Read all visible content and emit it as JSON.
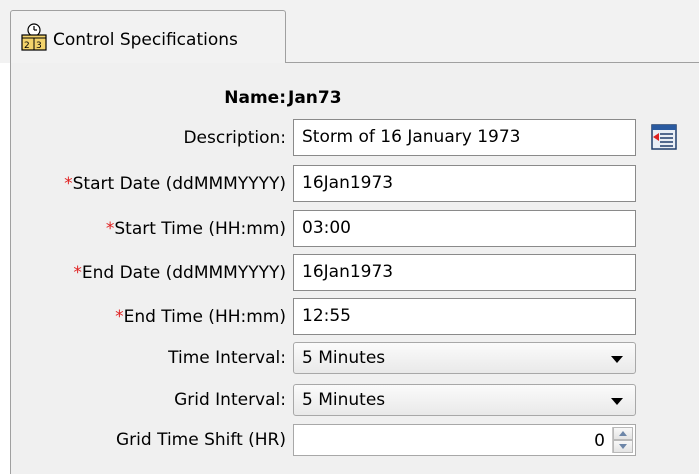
{
  "tab": {
    "label": "Control Specifications",
    "icon": "calendar-clock-icon"
  },
  "form": {
    "name_label": "Name:",
    "name_value": "Jan73",
    "description": {
      "label": "Description:",
      "value": "Storm of 16 January 1973",
      "edit_icon": "open-editor-icon"
    },
    "start_date": {
      "required_mark": "*",
      "label": "Start Date (ddMMMYYYY)",
      "value": "16Jan1973"
    },
    "start_time": {
      "required_mark": "*",
      "label": "Start Time (HH:mm)",
      "value": "03:00"
    },
    "end_date": {
      "required_mark": "*",
      "label": "End Date (ddMMMYYYY)",
      "value": "16Jan1973"
    },
    "end_time": {
      "required_mark": "*",
      "label": "End Time (HH:mm)",
      "value": "12:55"
    },
    "time_interval": {
      "label": "Time Interval:",
      "selected": "5 Minutes"
    },
    "grid_interval": {
      "label": "Grid Interval:",
      "selected": "5 Minutes"
    },
    "grid_time_shift": {
      "label": "Grid Time Shift (HR)",
      "value": "0"
    }
  },
  "colors": {
    "required_mark": "#e02020",
    "panel_background": "#f0f0f0",
    "field_background": "#ffffff"
  }
}
